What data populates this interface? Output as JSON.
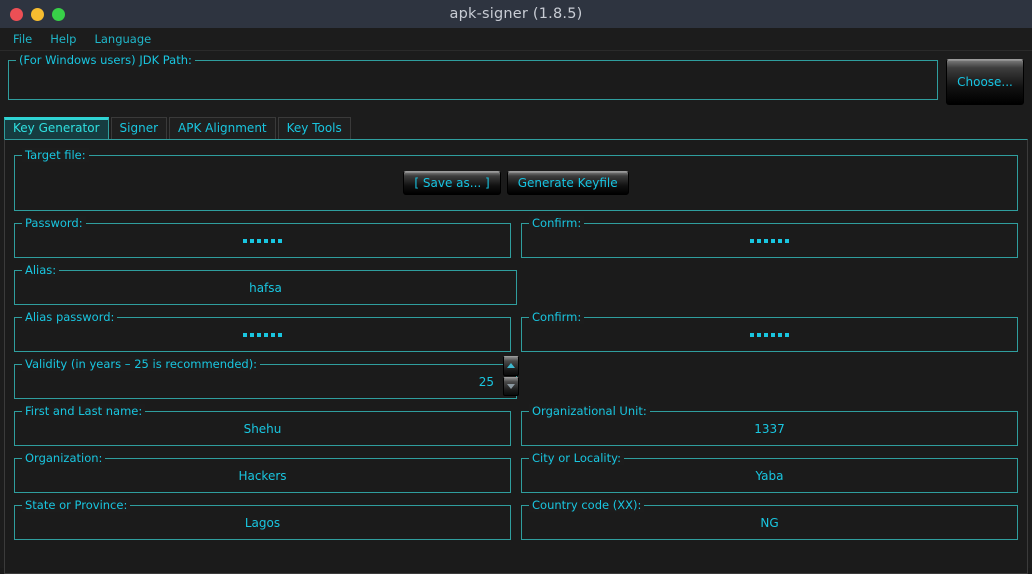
{
  "window": {
    "title": "apk-signer (1.8.5)",
    "controls": [
      "close",
      "minimize",
      "maximize"
    ],
    "accent_color": "#19c6e0",
    "border_color": "#2f9e9e",
    "titlebar_color": "#2e3440",
    "background_color": "#1c1c1c"
  },
  "menubar": {
    "items": [
      {
        "label": "File"
      },
      {
        "label": "Help"
      },
      {
        "label": "Language"
      }
    ]
  },
  "jdk": {
    "legend": "(For Windows users) JDK Path:",
    "value": "",
    "placeholder": "",
    "choose_label": "Choose..."
  },
  "tabs": [
    {
      "label": "Key Generator",
      "active": true
    },
    {
      "label": "Signer",
      "active": false
    },
    {
      "label": "APK Alignment",
      "active": false
    },
    {
      "label": "Key Tools",
      "active": false
    }
  ],
  "key_generator": {
    "target_file": {
      "legend": "Target file:",
      "save_as_label": "[ Save as... ]",
      "generate_label": "Generate Keyfile"
    },
    "fields": {
      "password": {
        "legend": "Password:",
        "value": "......",
        "masked": true,
        "dot_count": 6
      },
      "password_confirm": {
        "legend": "Confirm:",
        "value": "......",
        "masked": true,
        "dot_count": 6
      },
      "alias": {
        "legend": "Alias:",
        "value": "hafsa",
        "masked": false
      },
      "alias_password": {
        "legend": "Alias password:",
        "value": "......",
        "masked": true,
        "dot_count": 6
      },
      "alias_password_confirm": {
        "legend": "Confirm:",
        "value": "......",
        "masked": true,
        "dot_count": 6
      },
      "validity": {
        "legend": "Validity (in years – 25 is recommended):",
        "value": "25"
      },
      "first_last_name": {
        "legend": "First and Last name:",
        "value": "Shehu"
      },
      "organizational_unit": {
        "legend": "Organizational Unit:",
        "value": "1337"
      },
      "organization": {
        "legend": "Organization:",
        "value": "Hackers"
      },
      "city_or_locality": {
        "legend": "City or Locality:",
        "value": "Yaba"
      },
      "state_or_province": {
        "legend": "State or Province:",
        "value": "Lagos"
      },
      "country_code": {
        "legend": "Country code (XX):",
        "value": "NG"
      }
    }
  }
}
